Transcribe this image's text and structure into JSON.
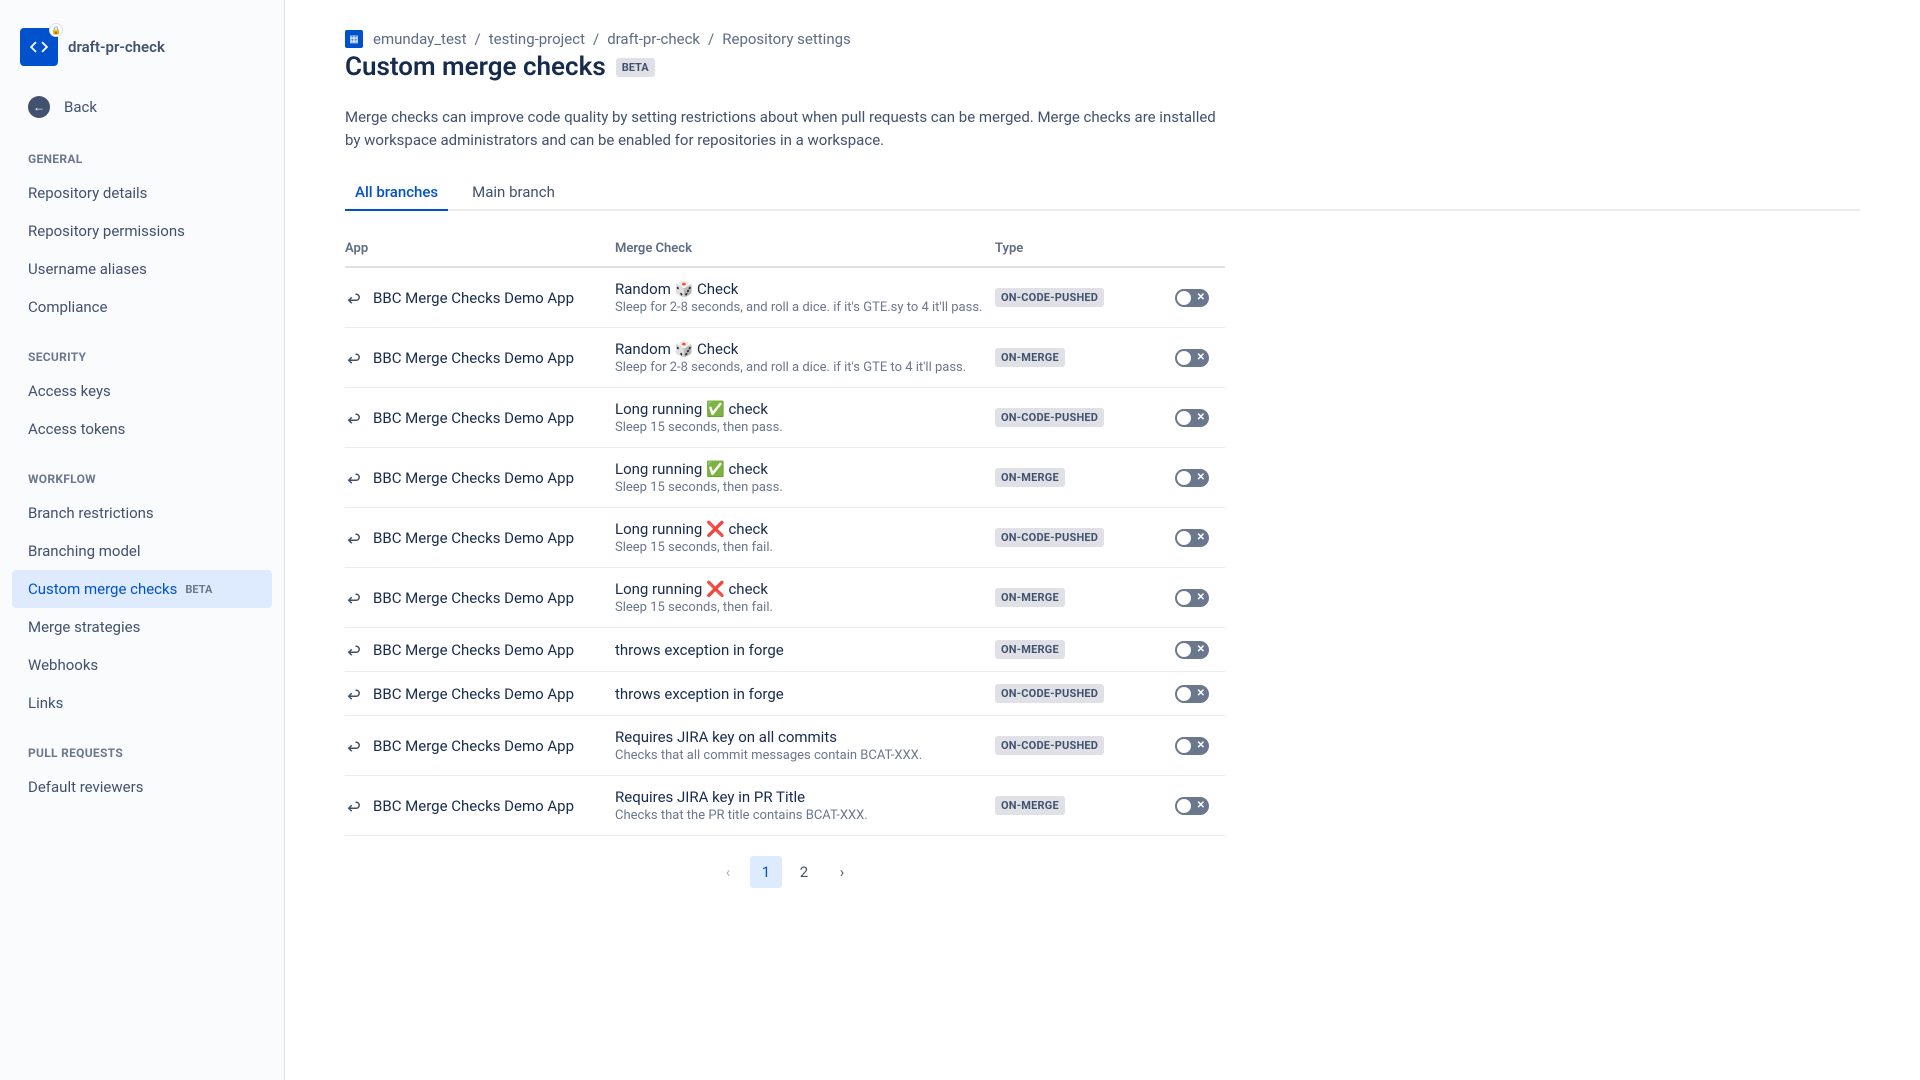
{
  "sidebar": {
    "repo_name": "draft-pr-check",
    "back_label": "Back",
    "sections": {
      "general": {
        "label": "GENERAL",
        "items": [
          "Repository details",
          "Repository permissions",
          "Username aliases",
          "Compliance"
        ]
      },
      "security": {
        "label": "SECURITY",
        "items": [
          "Access keys",
          "Access tokens"
        ]
      },
      "workflow": {
        "label": "WORKFLOW",
        "items": [
          {
            "label": "Branch restrictions",
            "active": false
          },
          {
            "label": "Branching model",
            "active": false
          },
          {
            "label": "Custom merge checks",
            "active": true,
            "badge": "BETA"
          },
          {
            "label": "Merge strategies",
            "active": false
          },
          {
            "label": "Webhooks",
            "active": false
          },
          {
            "label": "Links",
            "active": false
          }
        ]
      },
      "pull_requests": {
        "label": "PULL REQUESTS",
        "items": [
          "Default reviewers"
        ]
      }
    }
  },
  "breadcrumb": {
    "items": [
      "emunday_test",
      "testing-project",
      "draft-pr-check",
      "Repository settings"
    ]
  },
  "page": {
    "title": "Custom merge checks",
    "badge": "BETA",
    "description": "Merge checks can improve code quality by setting restrictions about when pull requests can be merged. Merge checks are installed by workspace administrators and can be enabled for repositories in a workspace."
  },
  "tabs": [
    {
      "label": "All branches",
      "active": true
    },
    {
      "label": "Main branch",
      "active": false
    }
  ],
  "table": {
    "headers": {
      "app": "App",
      "check": "Merge Check",
      "type": "Type"
    },
    "rows": [
      {
        "app": "BBC Merge Checks Demo App",
        "title": "Random 🎲 Check",
        "sub": "Sleep for 2-8 seconds, and roll a dice. if it's GTE.sy to 4 it'll pass.",
        "type": "ON-CODE-PUSHED"
      },
      {
        "app": "BBC Merge Checks Demo App",
        "title": "Random 🎲 Check",
        "sub": "Sleep for 2-8 seconds, and roll a dice. if it's GTE to 4 it'll pass.",
        "type": "ON-MERGE"
      },
      {
        "app": "BBC Merge Checks Demo App",
        "title": "Long running ✅ check",
        "sub": "Sleep 15 seconds, then pass.",
        "type": "ON-CODE-PUSHED"
      },
      {
        "app": "BBC Merge Checks Demo App",
        "title": "Long running ✅ check",
        "sub": "Sleep 15 seconds, then pass.",
        "type": "ON-MERGE"
      },
      {
        "app": "BBC Merge Checks Demo App",
        "title": "Long running ❌ check",
        "sub": "Sleep 15 seconds, then fail.",
        "type": "ON-CODE-PUSHED"
      },
      {
        "app": "BBC Merge Checks Demo App",
        "title": "Long running ❌ check",
        "sub": "Sleep 15 seconds, then fail.",
        "type": "ON-MERGE"
      },
      {
        "app": "BBC Merge Checks Demo App",
        "title": "throws exception in forge",
        "sub": "",
        "type": "ON-MERGE"
      },
      {
        "app": "BBC Merge Checks Demo App",
        "title": "throws exception in forge",
        "sub": "",
        "type": "ON-CODE-PUSHED"
      },
      {
        "app": "BBC Merge Checks Demo App",
        "title": "Requires JIRA key on all commits",
        "sub": "Checks that all commit messages contain BCAT-XXX.",
        "type": "ON-CODE-PUSHED"
      },
      {
        "app": "BBC Merge Checks Demo App",
        "title": "Requires JIRA key in PR Title",
        "sub": "Checks that the PR title contains BCAT-XXX.",
        "type": "ON-MERGE"
      }
    ]
  },
  "pagination": {
    "pages": [
      "1",
      "2"
    ],
    "current": "1"
  }
}
